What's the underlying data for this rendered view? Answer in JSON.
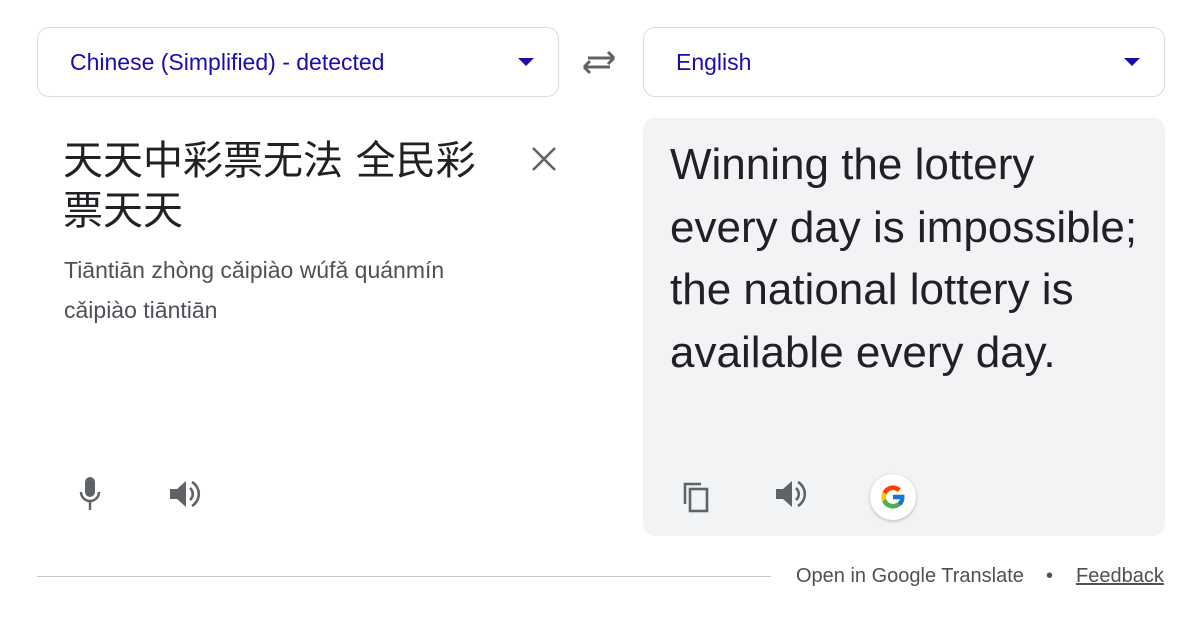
{
  "source_language": {
    "label": "Chinese (Simplified) - detected",
    "icon": "dropdown-caret"
  },
  "target_language": {
    "label": "English",
    "icon": "dropdown-caret"
  },
  "swap": {
    "icon": "swap-arrows-icon"
  },
  "source": {
    "text": "天天中彩票无法 全民彩票天天",
    "romanization": "Tiāntiān zhòng cǎipiào wúfǎ quánmín cǎipiào tiāntiān",
    "clear_icon": "close-icon",
    "mic_icon": "microphone-icon",
    "speaker_icon": "speaker-icon"
  },
  "target": {
    "text": "Winning the lottery every day is impossible; the national lottery is available every day.",
    "copy_icon": "copy-icon",
    "speaker_icon": "speaker-icon",
    "google_icon": "google-g-icon"
  },
  "footer": {
    "open_link": "Open in Google Translate",
    "separator": "•",
    "feedback_link": "Feedback"
  },
  "colors": {
    "accent": "#1a0dab",
    "icon_gray": "#5f6368",
    "panel_bg": "#f1f3f4",
    "text": "#202124"
  }
}
